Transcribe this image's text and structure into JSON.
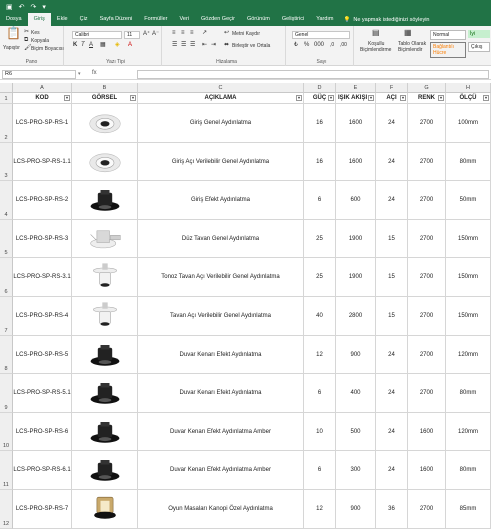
{
  "tabs": [
    "Dosya",
    "Giriş",
    "Ekle",
    "Çiz",
    "Sayfa Düzeni",
    "Formüller",
    "Veri",
    "Gözden Geçir",
    "Görünüm",
    "Geliştirici",
    "Yardım"
  ],
  "tellme": "Ne yapmak istediğinizi söyleyin",
  "ribbon": {
    "paste": "Yapıştır",
    "cut": "Kes",
    "copy": "Kopyala",
    "format_painter": "Biçim Boyacısı",
    "clipboard": "Pano",
    "font_name": "Calibri",
    "font_size": "11",
    "font_group": "Yazı Tipi",
    "wrap": "Metni Kaydır",
    "merge": "Birleştir ve Ortala",
    "alignment": "Hizalama",
    "number_format": "Genel",
    "number_group": "Sayı",
    "cond_format_1": "Koşullu",
    "cond_format_2": "Biçimlendirme",
    "table_format_1": "Tablo Olarak",
    "table_format_2": "Biçimlendir",
    "style_normal": "Normal",
    "style_good": "İyi",
    "style_bad": "Bağlantılı Hücre",
    "style_calc": "Çıkış"
  },
  "name_box": "R6",
  "fx": "fx",
  "columns": [
    "A",
    "B",
    "C",
    "D",
    "E",
    "F",
    "G",
    "H"
  ],
  "headers": [
    "KOD",
    "GÖRSEL",
    "AÇIKLAMA",
    "GÜÇ",
    "IŞIK AKIŞI",
    "AÇI",
    "RENK",
    "ÖLÇÜ"
  ],
  "rows": [
    {
      "num": "2",
      "kod": "LCS-PRO-SP-RS-1",
      "img": "recessed-spot-white",
      "aciklama": "Giriş Genel Aydınlatma",
      "guc": "16",
      "isik": "1600",
      "aci": "24",
      "renk": "2700",
      "olcu": "100mm"
    },
    {
      "num": "3",
      "kod": "LCS-PRO-SP-RS-1.1",
      "img": "recessed-spot-white-tilt",
      "aciklama": "Giriş Açı Verilebilir Genel Aydınlatma",
      "guc": "16",
      "isik": "1600",
      "aci": "24",
      "renk": "2700",
      "olcu": "80mm"
    },
    {
      "num": "4",
      "kod": "LCS-PRO-SP-RS-2",
      "img": "downlight-black",
      "aciklama": "Giriş Efekt Aydınlatma",
      "guc": "6",
      "isik": "600",
      "aci": "24",
      "renk": "2700",
      "olcu": "50mm"
    },
    {
      "num": "5",
      "kod": "LCS-PRO-SP-RS-3",
      "img": "recessed-white-driver",
      "aciklama": "Düz Tavan Genel Aydınlatma",
      "guc": "25",
      "isik": "1900",
      "aci": "15",
      "renk": "2700",
      "olcu": "150mm"
    },
    {
      "num": "6",
      "kod": "LCS-PRO-SP-RS-3.1",
      "img": "adjustable-white-spot",
      "aciklama": "Tonoz Tavan Açı Verilebilir Genel Aydınlatma",
      "guc": "25",
      "isik": "1900",
      "aci": "15",
      "renk": "2700",
      "olcu": "150mm"
    },
    {
      "num": "7",
      "kod": "LCS-PRO-SP-RS-4",
      "img": "adjustable-white-spot-tall",
      "aciklama": "Tavan Açı Verilebilir Genel Aydınlatma",
      "guc": "40",
      "isik": "2800",
      "aci": "15",
      "renk": "2700",
      "olcu": "150mm"
    },
    {
      "num": "8",
      "kod": "LCS-PRO-SP-RS-5",
      "img": "downlight-black",
      "aciklama": "Duvar Kenarı Efekt Aydınlatma",
      "guc": "12",
      "isik": "900",
      "aci": "24",
      "renk": "2700",
      "olcu": "120mm"
    },
    {
      "num": "9",
      "kod": "LCS-PRO-SP-RS-5.1",
      "img": "downlight-black",
      "aciklama": "Duvar Kenarı Efekt Aydınlatma",
      "guc": "6",
      "isik": "400",
      "aci": "24",
      "renk": "2700",
      "olcu": "80mm"
    },
    {
      "num": "10",
      "kod": "LCS-PRO-SP-RS-6",
      "img": "downlight-black",
      "aciklama": "Duvar Kenarı Efekt Aydınlatma Amber",
      "guc": "10",
      "isik": "500",
      "aci": "24",
      "renk": "1600",
      "olcu": "120mm"
    },
    {
      "num": "11",
      "kod": "LCS-PRO-SP-RS-6.1",
      "img": "downlight-black",
      "aciklama": "Duvar Kenarı Efekt Aydınlatma Amber",
      "guc": "6",
      "isik": "300",
      "aci": "24",
      "renk": "1600",
      "olcu": "80mm"
    },
    {
      "num": "12",
      "kod": "LCS-PRO-SP-RS-7",
      "img": "canopy-brass-spot",
      "aciklama": "Oyun Masaları Kanopi Özel Aydınlatma",
      "guc": "12",
      "isik": "900",
      "aci": "36",
      "renk": "2700",
      "olcu": "85mm"
    }
  ],
  "colors": {
    "accent": "#217346",
    "ribbon_bg": "#f3f3f3",
    "grid_line": "#d6d6d6"
  }
}
